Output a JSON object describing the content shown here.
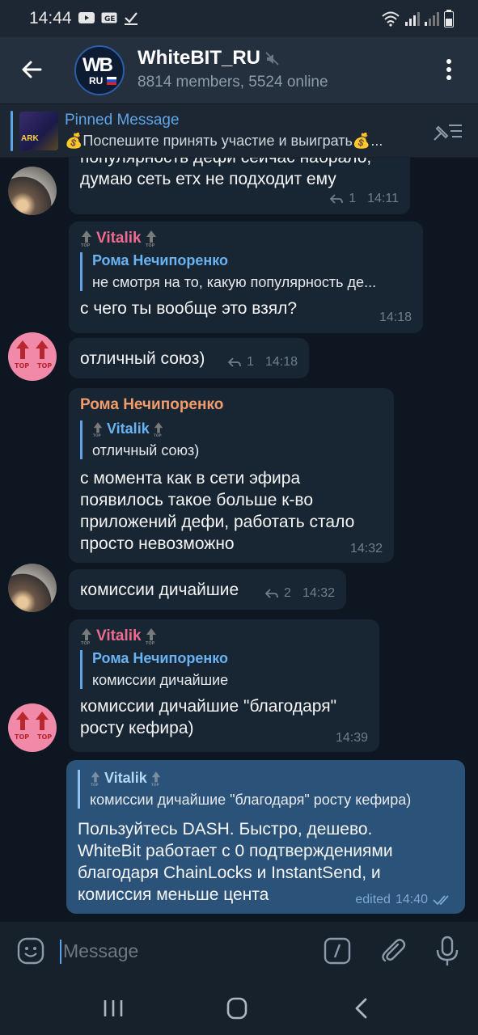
{
  "status_bar": {
    "time": "14:44",
    "left_icons": [
      "youtube-icon",
      "gallery-icon",
      "check-icon"
    ],
    "right_icons": [
      "wifi-icon",
      "signal-icon",
      "signal-icon",
      "battery-icon"
    ]
  },
  "header": {
    "title": "WhiteBIT_RU",
    "subtitle": "8814 members, 5524 online",
    "avatar_letters": "WB",
    "avatar_region": "RU",
    "muted": true
  },
  "pinned": {
    "label": "Pinned Message",
    "text": "💰Поспешите принять участие и выиграть💰...",
    "thumb_text": "ARK"
  },
  "messages": [
    {
      "text_lines": [
        "популярность дефи сейчас набрало,",
        "думаю сеть етх не подходит ему"
      ],
      "replies_count": "1",
      "time": "14:11"
    },
    {
      "sender": "Vitalik",
      "reply_to_name": "Рома Нечипоренко",
      "reply_to_text": "не смотря на то, какую популярность де...",
      "text": "с чего ты вообще это взял?",
      "time": "14:18"
    },
    {
      "text": "отличный союз)",
      "replies_count": "1",
      "time": "14:18"
    },
    {
      "sender": "Рома Нечипоренко",
      "reply_to_name": "Vitalik",
      "reply_to_text": "отличный союз)",
      "text_lines": [
        "с момента как в сети эфира",
        "появилось такое больше к-во",
        "приложений дефи, работать стало",
        "просто невозможно"
      ],
      "time": "14:32"
    },
    {
      "text": "комиссии дичайшие",
      "replies_count": "2",
      "time": "14:32"
    },
    {
      "sender": "Vitalik",
      "reply_to_name": "Рома Нечипоренко",
      "reply_to_text": "комиссии дичайшие",
      "text_lines": [
        "комиссии дичайшие \"благодаря\"",
        "росту кефира)"
      ],
      "time": "14:39"
    },
    {
      "reply_to_name": "Vitalik",
      "reply_to_text": "комиссии дичайшие \"благодаря\" росту кефира)",
      "text_lines": [
        "Пользуйтесь DASH. Быстро, дешево.",
        "WhiteBit работает с 0 подтверждениями",
        "благодаря ChainLocks и InstantSend, и",
        "комиссия меньше цента"
      ],
      "status": "edited",
      "time": "14:40"
    }
  ],
  "input": {
    "placeholder": "Message"
  },
  "colors": {
    "background": "#0e1621",
    "header": "#24303e",
    "incoming_bubble": "#182533",
    "outgoing_bubble": "#2b5278",
    "accent": "#5fa4e6",
    "sender_pink": "#ee6b8e",
    "sender_orange": "#f29c6b"
  }
}
